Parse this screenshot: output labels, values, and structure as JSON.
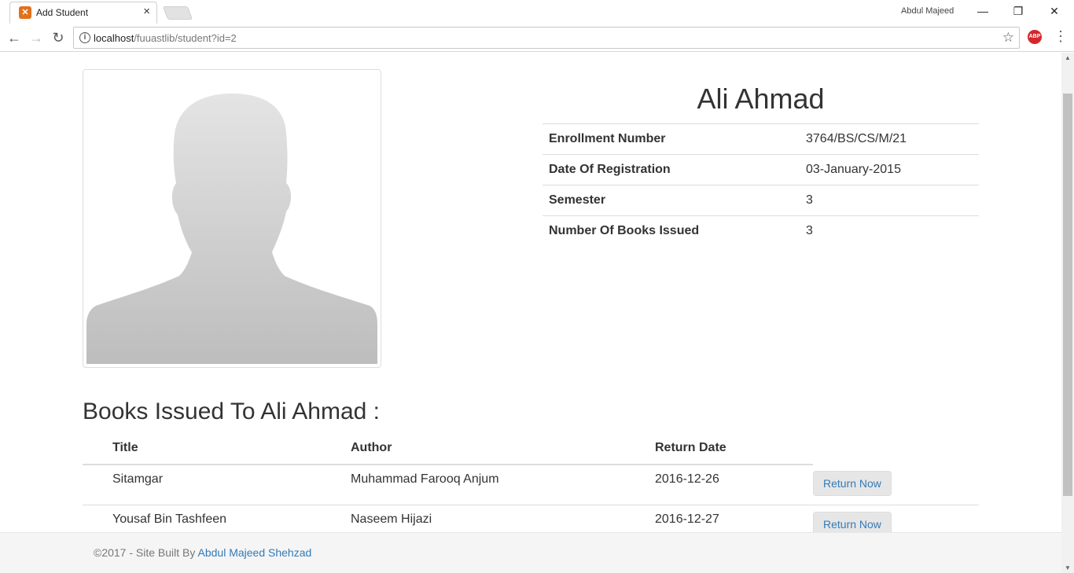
{
  "browser": {
    "tab_title": "Add Student",
    "tab_favicon": "xampp-icon",
    "profile_name": "Abdul Majeed",
    "url_host": "localhost",
    "url_path": "/fuuastlib/student?id=2",
    "icons": [
      "back-icon",
      "forward-icon",
      "reload-icon",
      "info-icon",
      "star-icon",
      "adblock-icon",
      "menu-icon"
    ]
  },
  "student": {
    "name": "Ali Ahmad",
    "details": [
      {
        "label": "Enrollment Number",
        "value": "3764/BS/CS/M/21"
      },
      {
        "label": "Date Of Registration",
        "value": "03-January-2015"
      },
      {
        "label": "Semester",
        "value": "3"
      },
      {
        "label": "Number Of Books Issued",
        "value": "3"
      }
    ]
  },
  "books": {
    "heading": "Books Issued To Ali Ahmad :",
    "columns": [
      "Title",
      "Author",
      "Return Date"
    ],
    "rows": [
      {
        "title": "Sitamgar",
        "author": "Muhammad Farooq Anjum",
        "return_date": "2016-12-26",
        "action": "Return Now"
      },
      {
        "title": "Yousaf Bin Tashfeen",
        "author": "Naseem Hijazi",
        "return_date": "2016-12-27",
        "action": "Return Now"
      }
    ]
  },
  "footer": {
    "text": "©2017 - Site Built By ",
    "link_text": "Abdul Majeed Shehzad"
  },
  "colors": {
    "link": "#337ab7",
    "footer_bg": "#f5f5f5",
    "button_bg": "#e6e6e6",
    "favicon": "#e2711d",
    "adblock": "#d6262a"
  }
}
